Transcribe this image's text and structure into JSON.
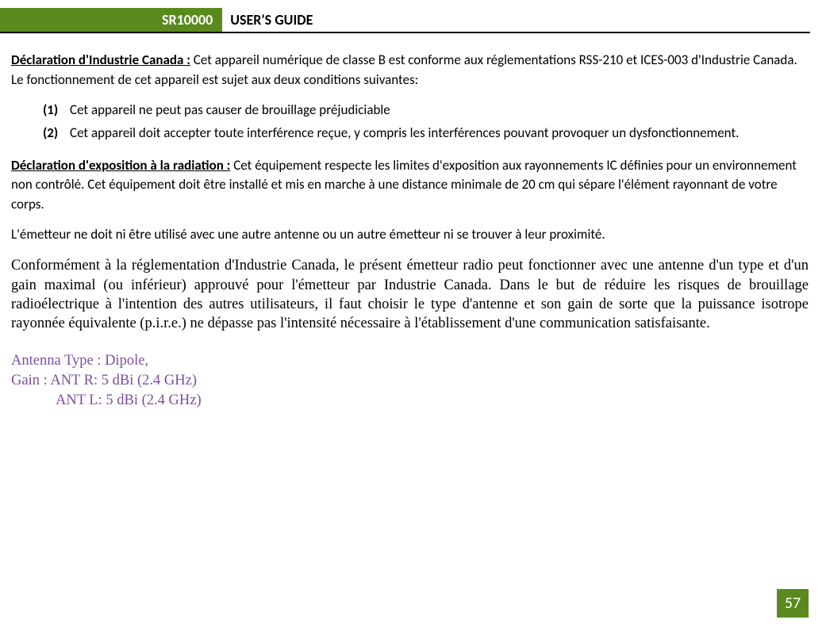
{
  "header": {
    "model": "SR10000",
    "title": "USER'S GUIDE"
  },
  "p1": {
    "lead": "Déclaration d'Industrie Canada :",
    "body": " Cet appareil numérique de classe B est conforme aux réglementations RSS-210 et ICES-003 d'Industrie Canada. Le fonctionnement de cet appareil est sujet aux deux conditions suivantes:"
  },
  "list": {
    "n1": "(1)",
    "t1": "Cet appareil ne peut pas causer de brouillage préjudiciable",
    "n2": "(2)",
    "t2": "Cet appareil doit accepter toute interférence reçue, y compris les interférences pouvant provoquer un dysfonctionnement."
  },
  "p2": {
    "lead": "Déclaration d'exposition à la radiation :",
    "body": " Cet équipement respecte les limites d'exposition aux rayonnements IC définies pour un environnement non contrôlé. Cet équipement doit être installé et mis en marche à une distance minimale de 20 cm qui sépare l'élément rayonnant de votre corps."
  },
  "p3": "L'émetteur ne doit ni être utilisé avec une autre antenne ou un autre émetteur ni se trouver à leur proximité.",
  "serif": "Conformément à la réglementation d'Industrie Canada, le présent émetteur radio peut fonctionner avec une antenne d'un type et d'un gain maximal (ou inférieur) approuvé pour l'émetteur par Industrie Canada. Dans le but de réduire les risques de brouillage radioélectrique à  l'intention des autres utilisateurs, il faut choisir le type d'antenne et son gain de sorte que la puissance isotrope rayonnée équivalente (p.i.r.e.) ne dépasse pas l'intensité nécessaire à l'établissement d'une communication satisfaisante.",
  "antenna": {
    "type": "Antenna Type : Dipole,",
    "gain1": "Gain : ANT R: 5 dBi (2.4 GHz)",
    "gain2": "ANT L: 5 dBi (2.4 GHz)"
  },
  "page": "57"
}
